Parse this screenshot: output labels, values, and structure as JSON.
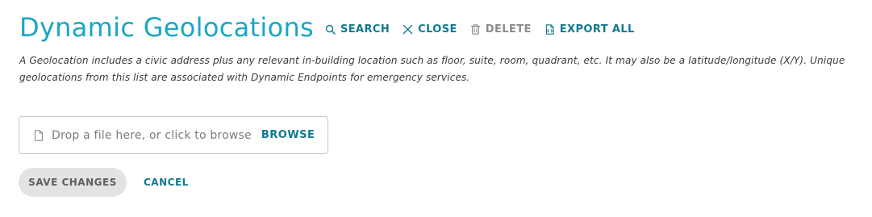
{
  "header": {
    "title": "Dynamic Geolocations",
    "actions": [
      {
        "label": "SEARCH",
        "icon": "search-icon",
        "enabled": true
      },
      {
        "label": "CLOSE",
        "icon": "close-icon",
        "enabled": true
      },
      {
        "label": "DELETE",
        "icon": "trash-icon",
        "enabled": false
      },
      {
        "label": "EXPORT ALL",
        "icon": "export-file-icon",
        "enabled": true
      }
    ]
  },
  "description": "A Geolocation includes a civic address plus any relevant in-building location such as floor, suite, room, quadrant, etc. It may also be a latitude/longitude (X/Y). Unique geolocations from this list are associated with Dynamic Endpoints for emergency services.",
  "upload": {
    "icon": "file-icon",
    "placeholder": "Drop a file here, or click to browse",
    "browse_label": "BROWSE"
  },
  "form": {
    "save_label": "SAVE CHANGES",
    "save_enabled": false,
    "cancel_label": "CANCEL"
  },
  "colors": {
    "title": "#1aa6c4",
    "accent": "#117a91",
    "disabled": "#8a8a8a",
    "button_disabled_bg": "#e3e3e3"
  }
}
